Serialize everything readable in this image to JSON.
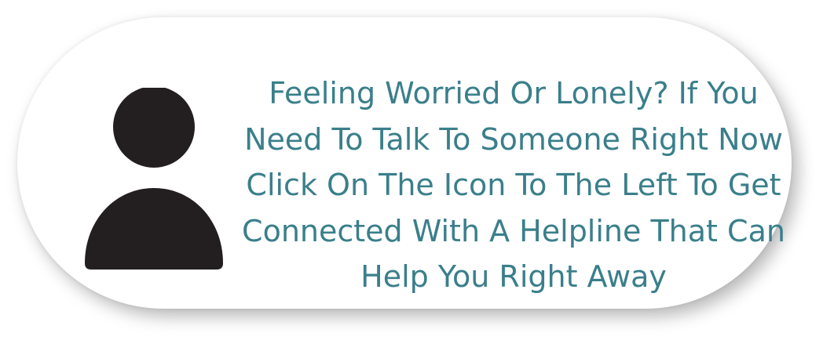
{
  "card": {
    "icon": "person-icon",
    "icon_color": "#231f20",
    "text_color": "#3a7f8b",
    "background": "#ffffff",
    "message_lines": [
      "Feeling Worried Or Lonely? If You",
      "Need To Talk To Someone Right Now",
      "Click On The Icon To The Left To Get",
      "Connected With A Helpline That Can",
      "Help You Right Away"
    ]
  }
}
